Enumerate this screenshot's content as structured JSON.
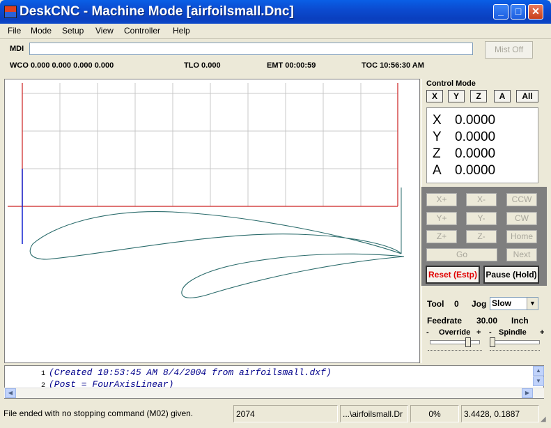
{
  "window": {
    "title": "DeskCNC - Machine Mode [airfoilsmall.Dnc]",
    "minimize": "_",
    "maximize": "□",
    "close": "✕"
  },
  "menu": [
    "File",
    "Mode",
    "Setup",
    "View",
    "Controller",
    "Help"
  ],
  "mdi": {
    "label": "MDI",
    "value": "",
    "mist_button": "Mist Off"
  },
  "status_row": {
    "wco": "WCO  0.000  0.000  0.000  0.000",
    "tlo": "TLO 0.000",
    "emt": "EMT 00:00:59",
    "toc": "TOC 10:56:30 AM"
  },
  "control": {
    "title": "Control Mode",
    "axis_buttons": [
      "X",
      "Y",
      "Z",
      "A",
      "All"
    ],
    "dro": [
      {
        "axis": "X",
        "value": "0.0000"
      },
      {
        "axis": "Y",
        "value": "0.0000"
      },
      {
        "axis": "Z",
        "value": "0.0000"
      },
      {
        "axis": "A",
        "value": "0.0000"
      }
    ],
    "jog_buttons": [
      "X+",
      "X-",
      "CCW",
      "Y+",
      "Y-",
      "CW",
      "Z+",
      "Z-",
      "Home",
      "Go",
      "Next"
    ],
    "reset": "Reset (Estp)",
    "pause": "Pause (Hold)",
    "tool_label": "Tool",
    "tool_value": "0",
    "jog_label": "Jog",
    "jog_speed": "Slow",
    "feedrate_label": "Feedrate",
    "feedrate_value": "30.00",
    "feedrate_unit": "Inch",
    "override_label": "Override",
    "spindle_label": "Spindle",
    "override_level": 0.8,
    "spindle_level": 0.0
  },
  "gcode": [
    {
      "line": "1",
      "text": "(Created 10:53:45 AM 8/4/2004 from airfoilsmall.dxf)"
    },
    {
      "line": "2",
      "text": "(Post = FourAxisLinear)"
    }
  ],
  "statusbar": {
    "message": "File ended with no stopping command (M02) given.",
    "count": "2074",
    "file": "...\\airfoilsmall.Dr",
    "percent": "0%",
    "coords": "3.4428, 0.1887"
  },
  "colors": {
    "grid": "#c8c8c8",
    "red_axis": "#cc2020",
    "blue_axis": "#1020d0",
    "toolpath": "#2a6b6b",
    "title_blue": "#0a52dd"
  }
}
